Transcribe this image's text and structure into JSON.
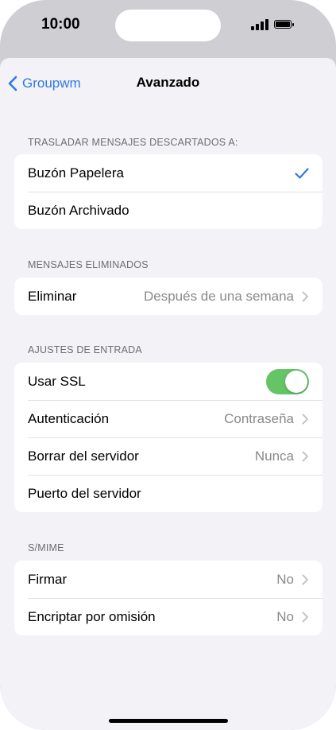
{
  "status": {
    "time": "10:00"
  },
  "nav": {
    "back_label": "Groupwm",
    "title": "Avanzado"
  },
  "sections": {
    "discarded": {
      "header": "TRASLADAR MENSAJES DESCARTADOS A:",
      "rows": [
        {
          "label": "Buzón Papelera",
          "selected": true
        },
        {
          "label": "Buzón Archivado",
          "selected": false
        }
      ]
    },
    "deleted": {
      "header": "MENSAJES ELIMINADOS",
      "rows": [
        {
          "label": "Eliminar",
          "value": "Después de una semana"
        }
      ]
    },
    "incoming": {
      "header": "AJUSTES DE ENTRADA",
      "rows": [
        {
          "label": "Usar SSL",
          "toggle_on": true
        },
        {
          "label": "Autenticación",
          "value": "Contraseña"
        },
        {
          "label": "Borrar del servidor",
          "value": "Nunca"
        },
        {
          "label": "Puerto del servidor",
          "value": ""
        }
      ]
    },
    "smime": {
      "header": "S/MIME",
      "rows": [
        {
          "label": "Firmar",
          "value": "No"
        },
        {
          "label": "Encriptar por omisión",
          "value": "No"
        }
      ]
    }
  },
  "colors": {
    "accent": "#2f7ae5",
    "toggle_on": "#65c466",
    "background": "#f2f2f7"
  },
  "icons": {
    "back": "chevron-left-icon",
    "check": "checkmark-icon",
    "disclosure": "chevron-right-icon"
  }
}
